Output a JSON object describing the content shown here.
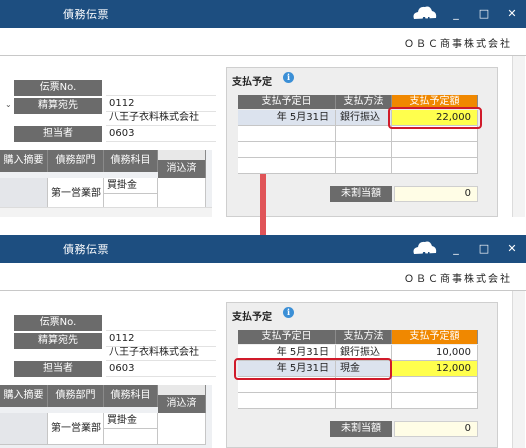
{
  "app": {
    "title": "債務伝票",
    "company": "ＯＢＣ商事株式会社",
    "ai_badge": "AI",
    "window_buttons": {
      "minimize": "_",
      "maximize": "□",
      "close": "✕"
    }
  },
  "form": {
    "voucher_no_label": "伝票No.",
    "settlement_label": "精算宛先",
    "settlement_code": "0112",
    "settlement_name": "八王子衣料株式会社",
    "person_label": "担当者",
    "person_code": "0603"
  },
  "grid": {
    "columns": [
      "購入摘要",
      "債務部門",
      "債務科目"
    ],
    "sub_header": "消込済",
    "row": {
      "department": "第一営業部",
      "account": "買掛金"
    }
  },
  "payment": {
    "title": "支払予定",
    "headers": {
      "date": "支払予定日",
      "method": "支払方法",
      "amount": "支払予定額"
    },
    "before_rows": [
      {
        "date": "年 5月31日",
        "method": "銀行振込",
        "amount": "22,000"
      }
    ],
    "after_rows": [
      {
        "date": "年 5月31日",
        "method": "銀行振込",
        "amount": "10,000"
      },
      {
        "date": "年 5月31日",
        "method": "現金",
        "amount": "12,000"
      }
    ],
    "unallocated_label": "未割当額",
    "unallocated_value": "0"
  },
  "colors": {
    "titlebar": "#1d4e80",
    "amount_header": "#f08800",
    "highlight": "#d01a2a",
    "selected_amount": "#ffff4d",
    "arrow": "#e05458"
  }
}
